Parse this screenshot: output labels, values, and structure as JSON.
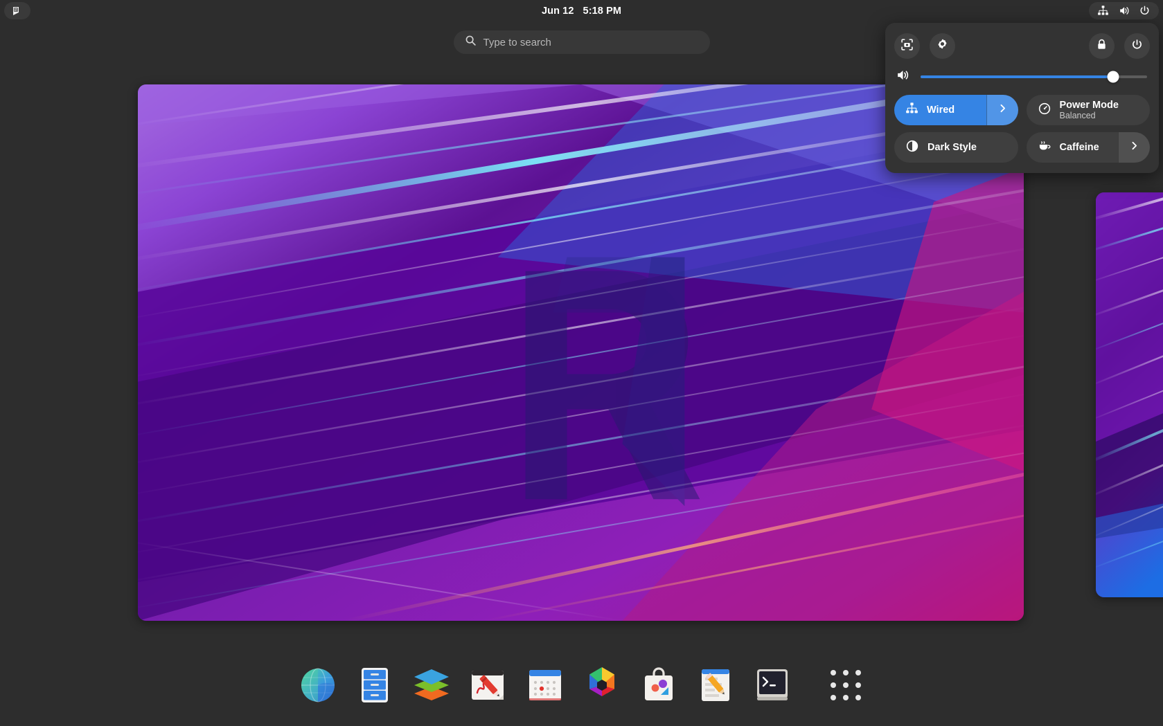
{
  "topbar": {
    "app_icon": "window-app-icon",
    "date": "Jun 12",
    "time": "5:18 PM",
    "status_icons": [
      "wired-network-icon",
      "volume-icon",
      "power-icon"
    ]
  },
  "search": {
    "placeholder": "Type to search",
    "value": "",
    "icon": "search-icon"
  },
  "overview": {
    "workspaces": [
      {
        "name": "workspace-1",
        "wallpaper": "purple-abstract-r-logo"
      },
      {
        "name": "workspace-2",
        "wallpaper": "purple-abstract-streaks"
      }
    ]
  },
  "quick_settings": {
    "buttons": {
      "screenshot": "screenshot-icon",
      "settings": "gear-icon",
      "lock": "lock-icon",
      "power": "power-icon"
    },
    "volume": {
      "icon": "volume-icon",
      "value": 85,
      "min": 0,
      "max": 100
    },
    "tiles": [
      {
        "id": "wired",
        "title": "Wired",
        "subtitle": "",
        "icon": "wired-network-icon",
        "active": true,
        "has_arrow": true,
        "arrow_icon": "chevron-right-icon"
      },
      {
        "id": "power-mode",
        "title": "Power Mode",
        "subtitle": "Balanced",
        "icon": "power-mode-gauge-icon",
        "active": false,
        "has_arrow": false,
        "arrow_icon": ""
      },
      {
        "id": "dark-style",
        "title": "Dark Style",
        "subtitle": "",
        "icon": "dark-style-contrast-icon",
        "active": false,
        "has_arrow": false,
        "arrow_icon": ""
      },
      {
        "id": "caffeine",
        "title": "Caffeine",
        "subtitle": "",
        "icon": "coffee-cup-icon",
        "active": false,
        "has_arrow": true,
        "arrow_icon": "chevron-right-icon"
      }
    ]
  },
  "dock": {
    "items": [
      {
        "id": "web",
        "label": "Web",
        "icon": "globe-browser-icon"
      },
      {
        "id": "files",
        "label": "Files",
        "icon": "file-cabinet-icon"
      },
      {
        "id": "layers",
        "label": "Layers",
        "icon": "stacked-layers-icon"
      },
      {
        "id": "drawing",
        "label": "Drawing",
        "icon": "crayon-drawing-icon"
      },
      {
        "id": "calendar",
        "label": "Calendar",
        "icon": "calendar-icon"
      },
      {
        "id": "photos",
        "label": "Photos",
        "icon": "hexagon-photos-icon"
      },
      {
        "id": "software",
        "label": "Software",
        "icon": "shopping-bag-software-icon"
      },
      {
        "id": "text-editor",
        "label": "Text Editor",
        "icon": "pencil-document-icon"
      },
      {
        "id": "terminal",
        "label": "Terminal",
        "icon": "terminal-prompt-icon"
      },
      {
        "id": "show-apps",
        "label": "Show Applications",
        "icon": "app-grid-icon"
      }
    ]
  },
  "colors": {
    "accent": "#3584e4",
    "panel_bg": "#333333",
    "desktop_bg": "#2d2d2d",
    "tile_bg": "#3f3f3f"
  }
}
